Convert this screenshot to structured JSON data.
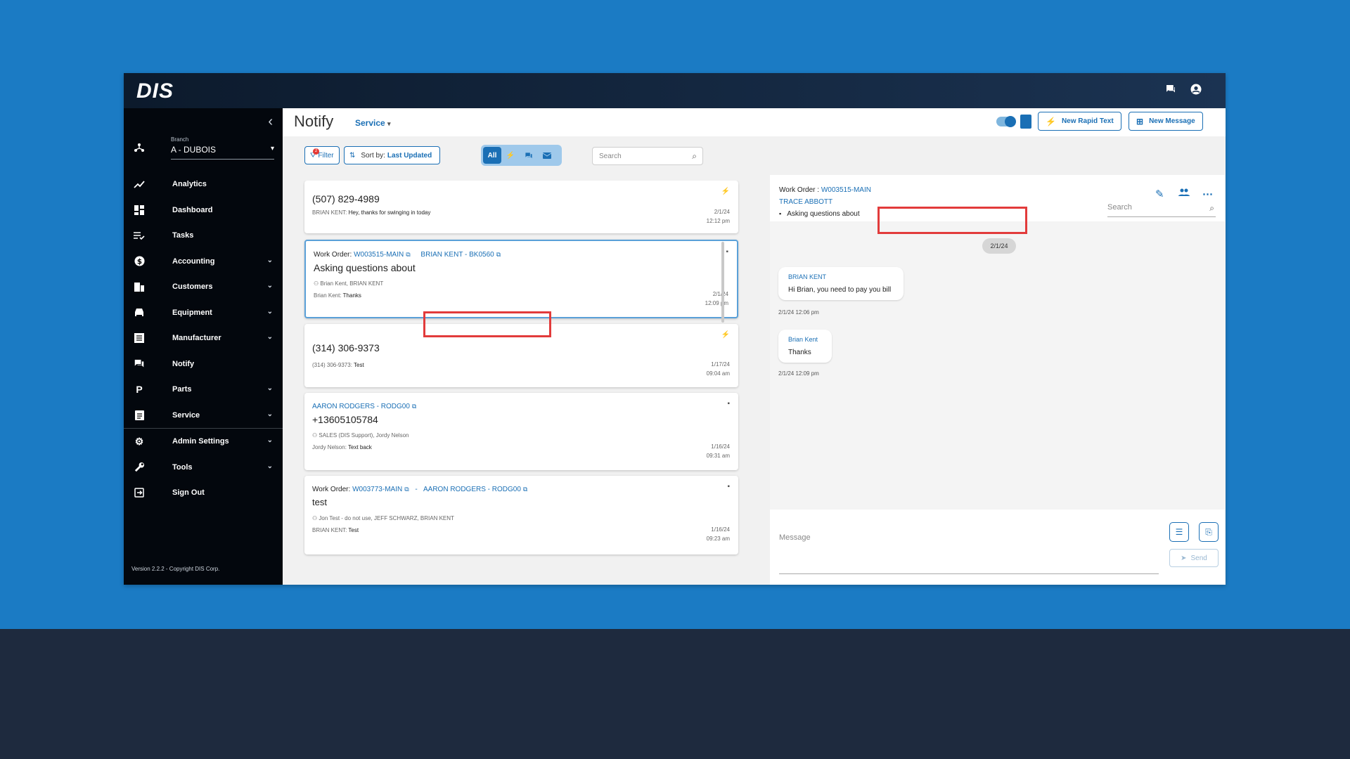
{
  "app": {
    "logo": "DIS"
  },
  "sidebar": {
    "branch_label": "Branch",
    "branch_value": "A - DUBOIS",
    "items": [
      {
        "label": "Analytics",
        "icon": "analytics-icon",
        "expandable": false
      },
      {
        "label": "Dashboard",
        "icon": "dashboard-icon",
        "expandable": false
      },
      {
        "label": "Tasks",
        "icon": "tasks-icon",
        "expandable": false
      },
      {
        "label": "Accounting",
        "icon": "dollar-icon",
        "expandable": true
      },
      {
        "label": "Customers",
        "icon": "customers-icon",
        "expandable": true
      },
      {
        "label": "Equipment",
        "icon": "car-icon",
        "expandable": true
      },
      {
        "label": "Manufacturer",
        "icon": "manufacturer-icon",
        "expandable": true
      },
      {
        "label": "Notify",
        "icon": "chat-icon",
        "expandable": false
      },
      {
        "label": "Parts",
        "icon": "parts-icon",
        "expandable": true
      },
      {
        "label": "Service",
        "icon": "clipboard-icon",
        "expandable": true
      },
      {
        "label": "Admin Settings",
        "icon": "gear-icon",
        "expandable": true
      },
      {
        "label": "Tools",
        "icon": "wrench-icon",
        "expandable": true
      },
      {
        "label": "Sign Out",
        "icon": "sign-out-icon",
        "expandable": false
      }
    ],
    "version": "Version 2.2.2 - Copyright DIS Corp."
  },
  "header": {
    "title": "Notify",
    "module": "Service",
    "new_rapid_text": "New Rapid Text",
    "new_message": "New Message"
  },
  "toolbar": {
    "filter_label": "Filter",
    "filter_badge": "2",
    "sort_label": "Sort by:",
    "sort_value": "Last Updated",
    "segment_all": "All",
    "search_placeholder": "Search"
  },
  "list": {
    "card1": {
      "phone": "(507) 829-4989",
      "sender": "BRIAN KENT:",
      "text": "Hey, thanks for swinging in today",
      "date": "2/1/24",
      "time": "12:12 pm"
    },
    "card2": {
      "wo_label": "Work Order:",
      "wo_link": "W003515-MAIN",
      "customer_link": "BRIAN KENT - BK0560",
      "subject": "Asking questions about",
      "participants": "Brian Kent, BRIAN KENT",
      "sender": "Brian Kent:",
      "text": "Thanks",
      "date": "2/1/24",
      "time": "12:09 pm"
    },
    "card3": {
      "phone": "(314) 306-9373",
      "sender": "(314) 306-9373:",
      "text": "Test",
      "date": "1/17/24",
      "time": "09:04 am"
    },
    "card4": {
      "customer_link": "AARON RODGERS - RODG00",
      "phone": "+13605105784",
      "participants": "SALES (DIS Support), Jordy Nelson",
      "sender": "Jordy Nelson:",
      "text": "Text back",
      "date": "1/16/24",
      "time": "09:31 am"
    },
    "card5": {
      "wo_label": "Work Order:",
      "wo_link": "W003773-MAIN",
      "separator": "-",
      "customer_link": "AARON RODGERS - RODG00",
      "subject": "test",
      "participants": "Jon Test - do not use, JEFF SCHWARZ, BRIAN KENT",
      "sender": "BRIAN KENT:",
      "text": "Test",
      "date": "1/16/24",
      "time": "09:23 am"
    }
  },
  "conversation": {
    "wo_label": "Work Order :",
    "wo_link": "W003515-MAIN",
    "contact": "TRACE ABBOTT",
    "subject": "Asking questions about",
    "search_placeholder": "Search",
    "day": "2/1/24",
    "messages": [
      {
        "name": "BRIAN KENT",
        "text": "Hi Brian, you need to pay you bill",
        "time": "2/1/24 12:06 pm"
      },
      {
        "name": "Brian Kent",
        "text": "Thanks",
        "time": "2/1/24 12:09 pm"
      }
    ],
    "message_placeholder": "Message",
    "send_label": "Send"
  },
  "colors": {
    "accent": "#1a6fb5",
    "highlight": "#e23b3b",
    "sidebar": "#03070d",
    "background": "#1b7bc4"
  }
}
